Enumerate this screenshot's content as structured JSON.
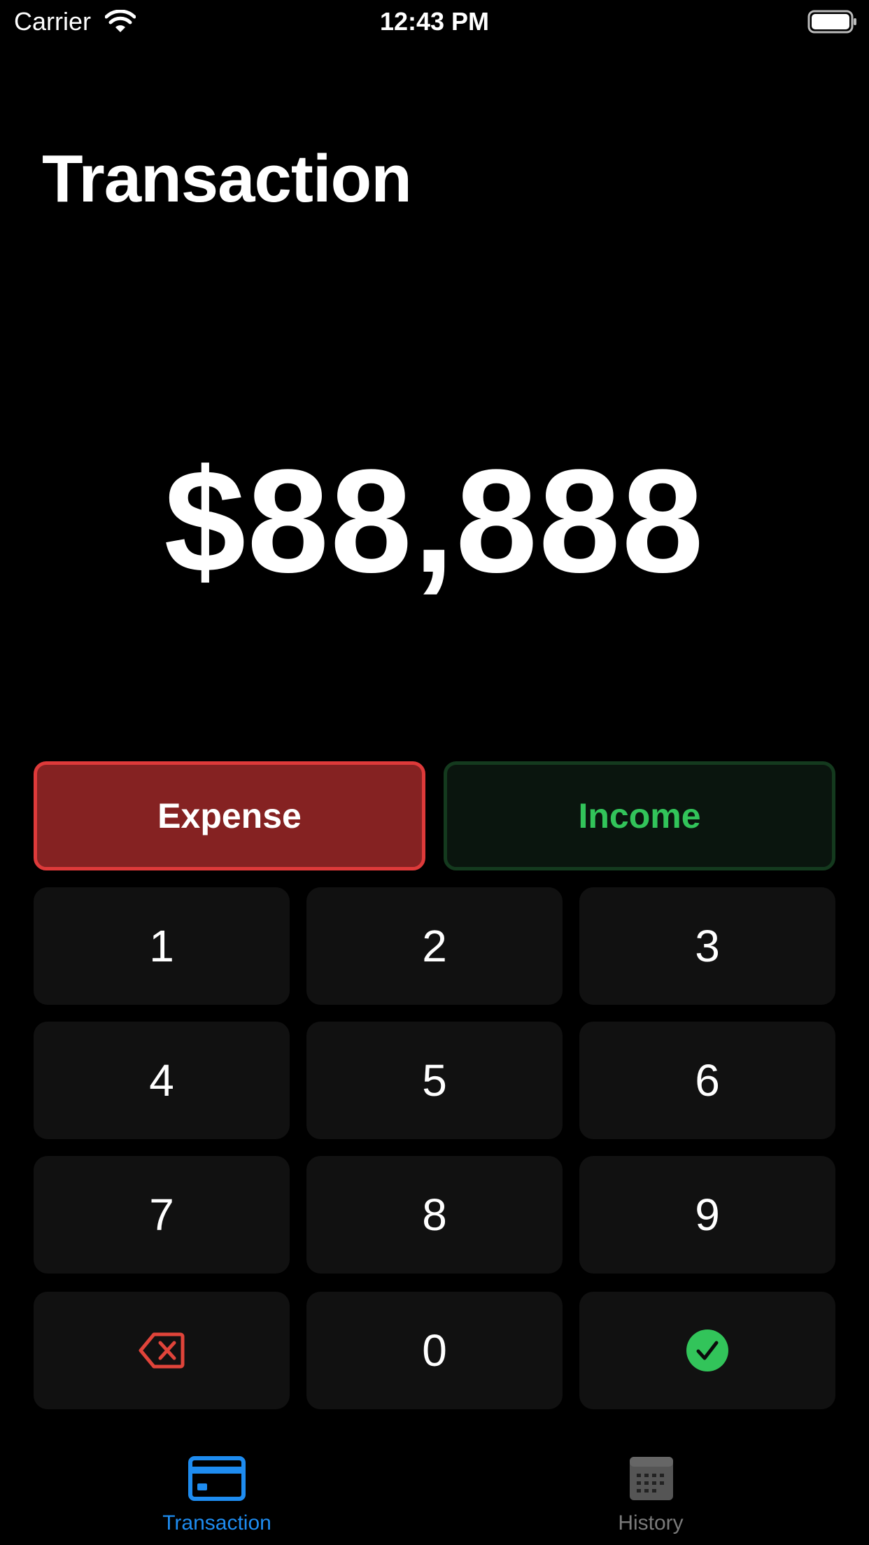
{
  "status_bar": {
    "carrier": "Carrier",
    "time": "12:43 PM",
    "wifi_icon": "wifi-icon",
    "battery_icon": "battery-icon"
  },
  "header": {
    "title": "Transaction"
  },
  "amount": {
    "display": "$88,888"
  },
  "type_toggle": {
    "expense_label": "Expense",
    "income_label": "Income",
    "selected": "Expense",
    "expense_color": "#852222",
    "expense_border": "#de3a3a",
    "income_color": "#32c45a"
  },
  "keypad": {
    "keys": [
      "1",
      "2",
      "3",
      "4",
      "5",
      "6",
      "7",
      "8",
      "9"
    ],
    "zero": "0",
    "backspace_icon": "backspace-icon",
    "confirm_icon": "checkmark-circle-icon"
  },
  "tab_bar": {
    "tabs": [
      {
        "label": "Transaction",
        "icon": "credit-card-icon",
        "active": true
      },
      {
        "label": "History",
        "icon": "calendar-icon",
        "active": false
      }
    ],
    "active_color": "#1e8cf0",
    "inactive_color": "#7a7a7a"
  }
}
